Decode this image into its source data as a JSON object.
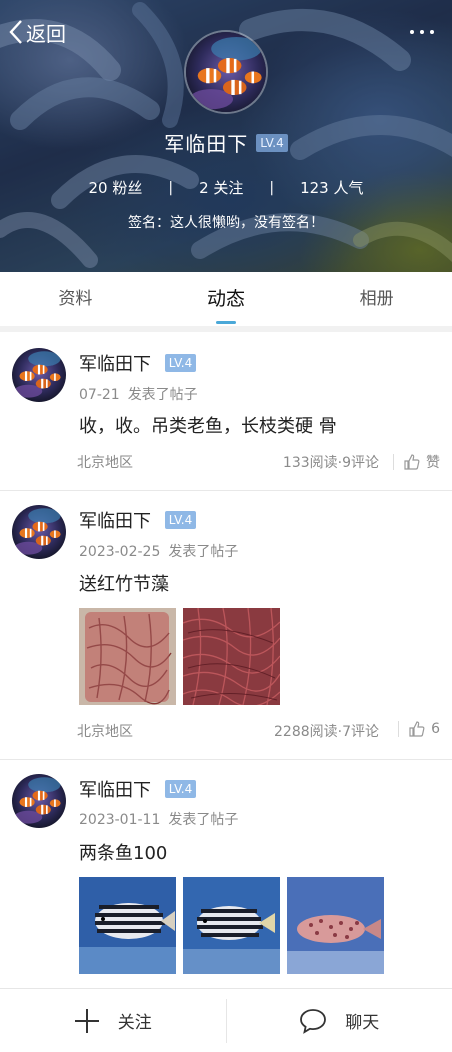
{
  "header": {
    "back_label": "返回",
    "more_icon": "more-dots-icon",
    "profile": {
      "name": "军临田下",
      "level": "LV.4",
      "fans": "20 粉丝",
      "follows": "2 关注",
      "popularity": "123 人气",
      "signature": "签名：这人很懒哟，没有签名！"
    }
  },
  "tabs": [
    {
      "label": "资料",
      "active": false
    },
    {
      "label": "动态",
      "active": true
    },
    {
      "label": "相册",
      "active": false
    }
  ],
  "posts": [
    {
      "author": "军临田下",
      "level": "LV.4",
      "date": "07-21",
      "action": "发表了帖子",
      "content": "收，收。吊类老鱼，长枝类硬 骨",
      "location": "北京地区",
      "stats": "133阅读·9评论",
      "likes": "赞",
      "images": []
    },
    {
      "author": "军临田下",
      "level": "LV.4",
      "date": "2023-02-25",
      "action": "发表了帖子",
      "content": "送红竹节藻",
      "location": "北京地区",
      "stats": "2288阅读·7评论",
      "likes": "6",
      "images": [
        "red-algae-bag-photo",
        "red-algae-pile-photo"
      ]
    },
    {
      "author": "军临田下",
      "level": "LV.4",
      "date": "2023-01-11",
      "action": "发表了帖子",
      "content": "两条鱼100",
      "images": [
        "striped-sweetlips-photo-1",
        "striped-sweetlips-photo-2",
        "spotted-grouper-photo"
      ]
    }
  ],
  "bottom_bar": {
    "follow_label": "关注",
    "chat_label": "聊天"
  },
  "colors": {
    "accent": "#4aa8d8",
    "level_badge": "#8fb8e6",
    "muted_text": "#8a8a8a"
  }
}
